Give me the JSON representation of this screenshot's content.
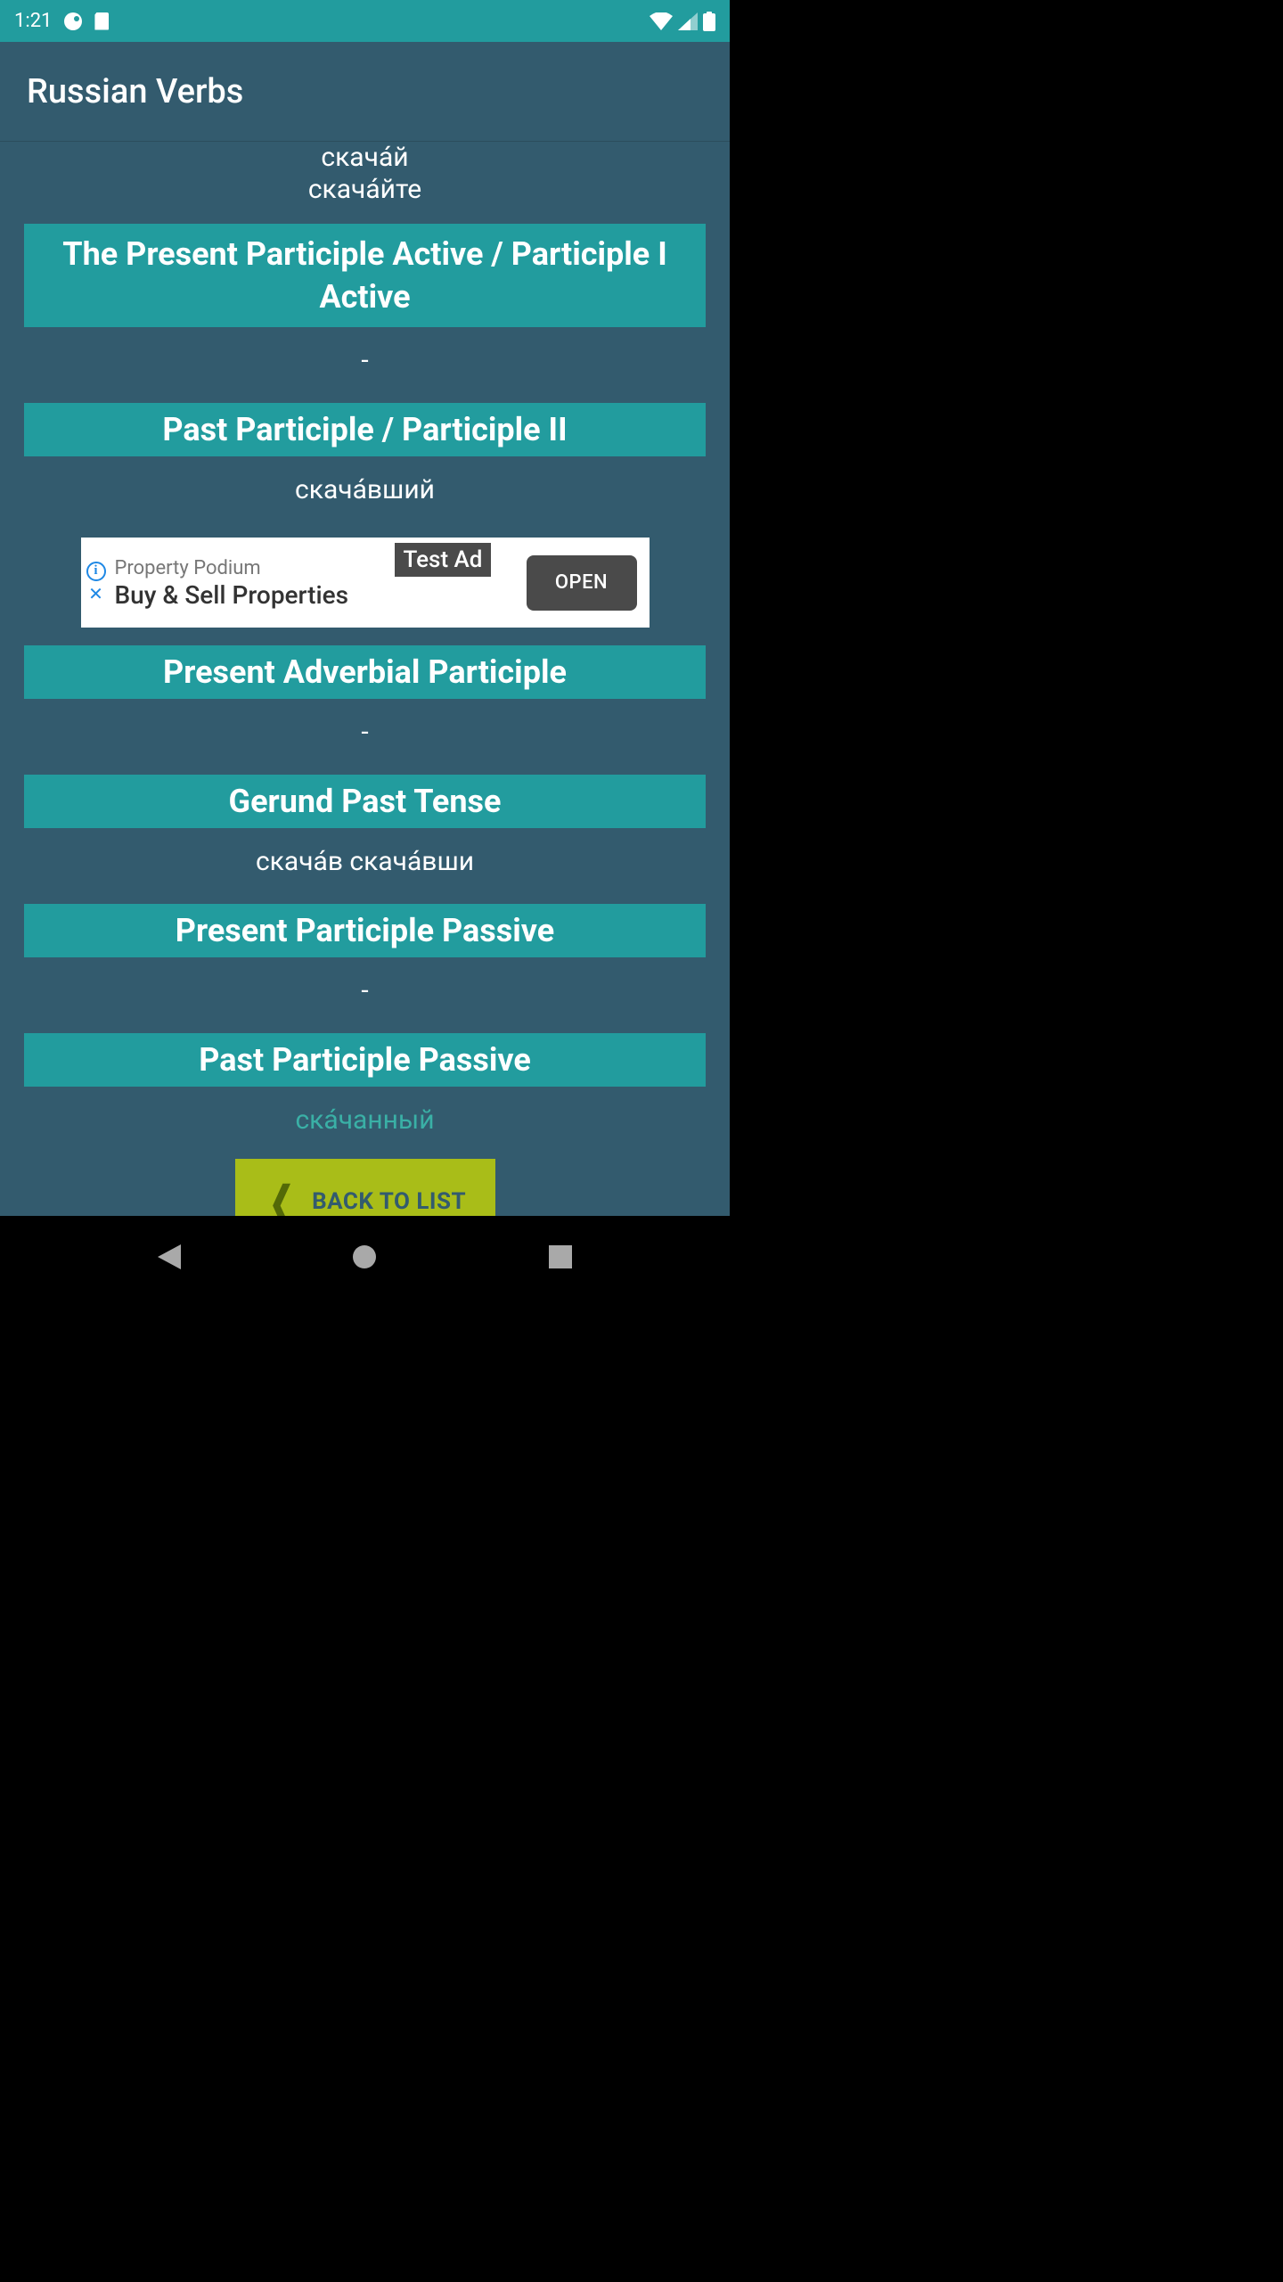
{
  "status": {
    "time": "1:21"
  },
  "app": {
    "title": "Russian Verbs"
  },
  "top_verbs": {
    "line1": "скача́й",
    "line2": "скача́йте"
  },
  "sections": [
    {
      "header": "The Present Participle Active / Participle I Active",
      "value": "-",
      "link": false
    },
    {
      "header": "Past Participle / Participle II",
      "value": "скача́вший",
      "link": false
    },
    {
      "header": "Present Adverbial Participle",
      "value": "-",
      "link": false
    },
    {
      "header": "Gerund Past Tense",
      "value": "скача́в скача́вши",
      "link": false
    },
    {
      "header": "Present Participle Passive",
      "value": "-",
      "link": false
    },
    {
      "header": "Past Participle Passive",
      "value": "ска́чанный",
      "link": true
    }
  ],
  "ad": {
    "badge": "Test Ad",
    "title": "Property Podium",
    "subtitle": "Buy & Sell Properties",
    "button": "OPEN"
  },
  "back": {
    "label": "BACK TO LIST"
  }
}
